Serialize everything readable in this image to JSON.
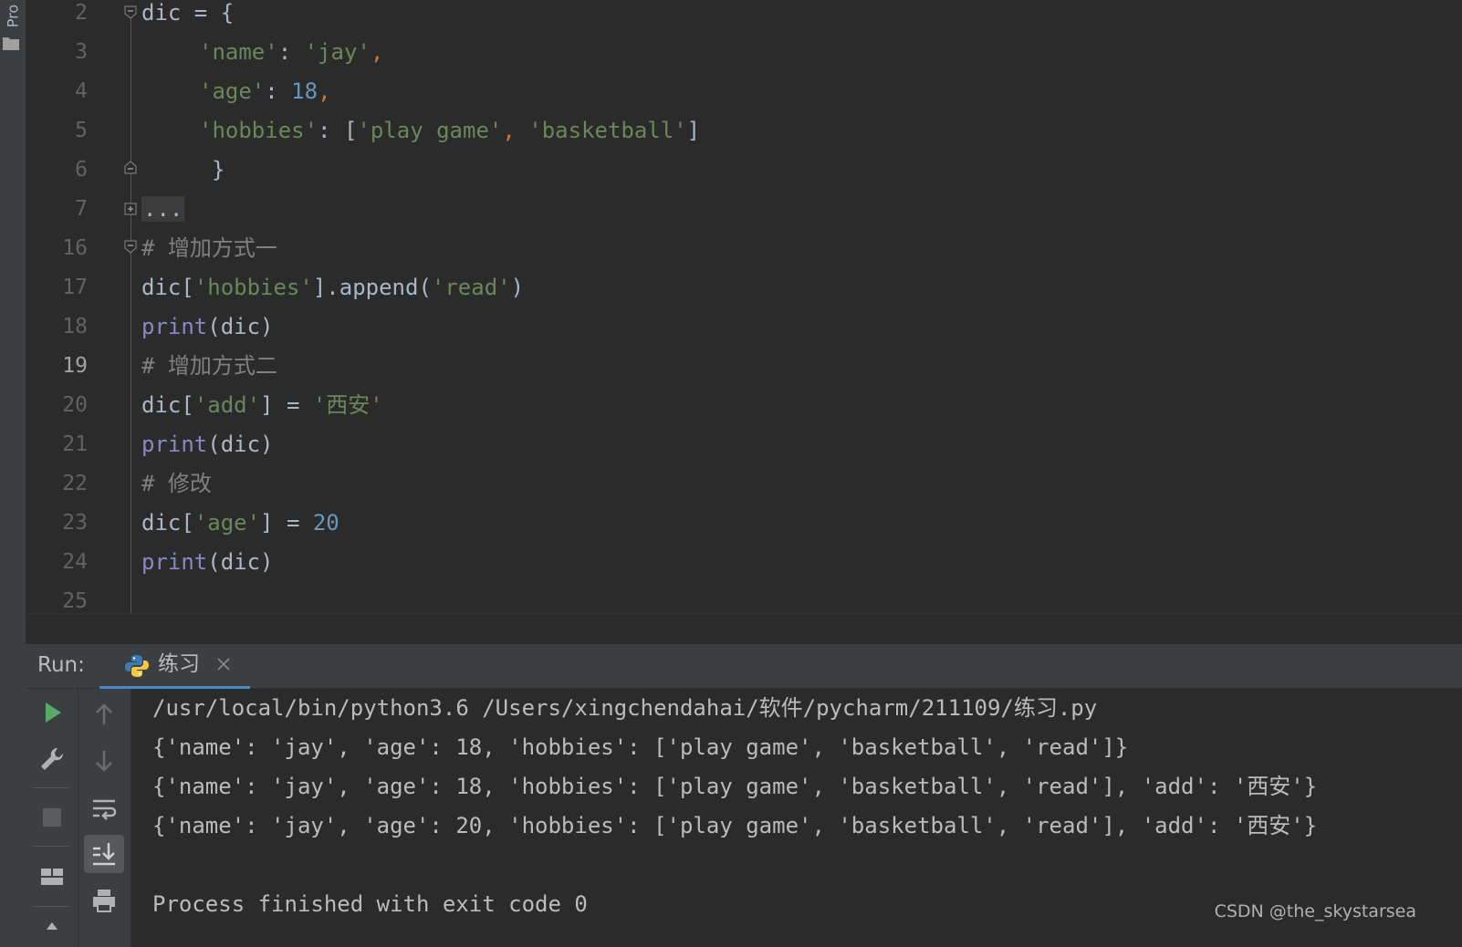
{
  "project_tab": {
    "label": "Pro"
  },
  "editor": {
    "line_numbers": [
      "2",
      "3",
      "4",
      "5",
      "6",
      "7",
      "16",
      "17",
      "18",
      "19",
      "20",
      "21",
      "22",
      "23",
      "24",
      "25"
    ],
    "current_line": "19",
    "code": {
      "l2": {
        "a": "dic = {"
      },
      "l3": {
        "key": "'name'",
        "colon": ": ",
        "val": "'jay'",
        "comma": ","
      },
      "l4": {
        "key": "'age'",
        "colon": ": ",
        "val": "18",
        "comma": ","
      },
      "l5": {
        "key": "'hobbies'",
        "colon": ": ",
        "open": "[",
        "v1": "'play game'",
        "comma": ", ",
        "v2": "'basketball'",
        "close": "]"
      },
      "l6": {
        "a": "}"
      },
      "l7": {
        "folded": "..."
      },
      "l16": {
        "comment": "# 增加方式一"
      },
      "l17": {
        "a": "dic[",
        "key": "'hobbies'",
        "b": "].append(",
        "val": "'read'",
        "c": ")"
      },
      "l18": {
        "fn": "print",
        "args": "(dic)"
      },
      "l19": {
        "comment": "# 增加方式二"
      },
      "l20": {
        "a": "dic[",
        "key": "'add'",
        "b": "] = ",
        "val": "'西安'"
      },
      "l21": {
        "fn": "print",
        "args": "(dic)"
      },
      "l22": {
        "comment": "# 修改"
      },
      "l23": {
        "a": "dic[",
        "key": "'age'",
        "b": "] = ",
        "val": "20"
      },
      "l24": {
        "fn": "print",
        "args": "(dic)"
      }
    }
  },
  "run_panel": {
    "label": "Run:",
    "tab_title": "练习",
    "console_lines": [
      "/usr/local/bin/python3.6 /Users/xingchendahai/软件/pycharm/211109/练习.py",
      "{'name': 'jay', 'age': 18, 'hobbies': ['play game', 'basketball', 'read']}",
      "{'name': 'jay', 'age': 18, 'hobbies': ['play game', 'basketball', 'read'], 'add': '西安'}",
      "{'name': 'jay', 'age': 20, 'hobbies': ['play game', 'basketball', 'read'], 'add': '西安'}",
      "",
      "Process finished with exit code 0"
    ]
  },
  "watermark": "CSDN @the_skystarsea",
  "colors": {
    "background": "#2b2b2b",
    "string": "#6a8759",
    "number": "#6897bb",
    "keyword_punct": "#cc7832",
    "builtin": "#8888c6",
    "comment": "#808080",
    "run_green": "#59a869"
  }
}
